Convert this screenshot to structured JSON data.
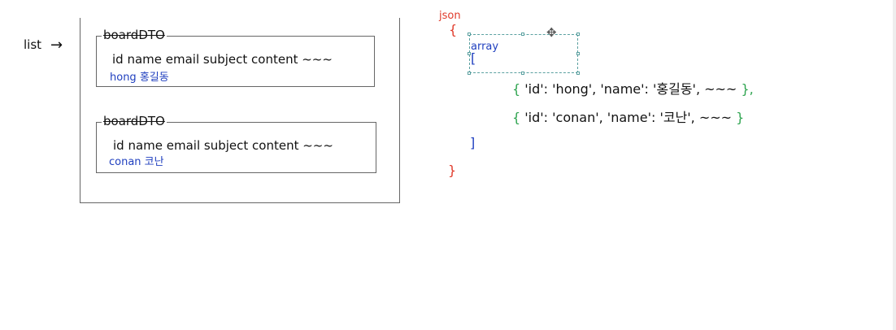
{
  "left": {
    "list_label": "list",
    "arrow": "→",
    "dto_boxes": [
      {
        "title": "boardDTO",
        "fields": "id  name  email  subject content ~~~",
        "values": "hong 홍길동"
      },
      {
        "title": "boardDTO",
        "fields": "id  name  email  subject content ~~~",
        "values": "conan 코난"
      }
    ]
  },
  "right": {
    "json_label": "json",
    "open_brace": "{",
    "close_brace": "}",
    "array_label": "array",
    "open_bracket": "[",
    "close_bracket": "]",
    "items": [
      {
        "open": "{",
        "text": " 'id': 'hong', 'name': '홍길동', ~~~ ",
        "close": "},"
      },
      {
        "open": "{",
        "text": " 'id': 'conan', 'name': '코난', ~~~ ",
        "close": "}"
      }
    ],
    "move_icon": "✥"
  },
  "colors": {
    "json_red": "#e03a2a",
    "array_blue": "#1f3fbf",
    "brace_green": "#2ea44f"
  }
}
